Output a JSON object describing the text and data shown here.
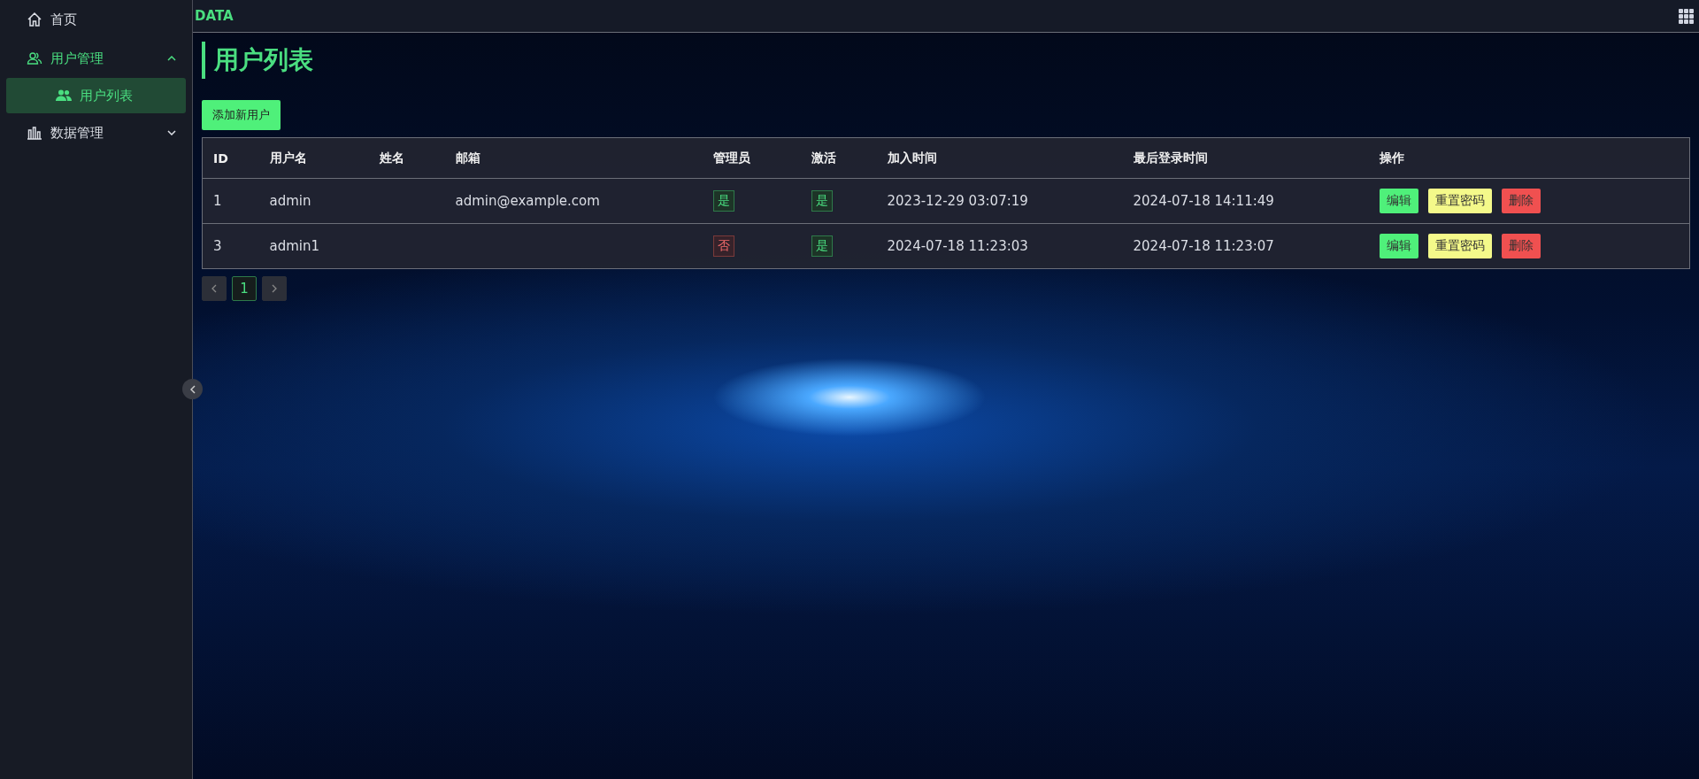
{
  "sidebar": {
    "items": [
      {
        "label": "首页"
      },
      {
        "label": "用户管理",
        "expanded": true,
        "children": [
          {
            "label": "用户列表",
            "selected": true
          }
        ]
      },
      {
        "label": "数据管理",
        "expanded": false
      }
    ]
  },
  "topbar": {
    "brand": "DATA"
  },
  "page": {
    "title": "用户列表",
    "add_button": "添加新用户"
  },
  "table": {
    "columns": [
      "ID",
      "用户名",
      "姓名",
      "邮箱",
      "管理员",
      "激活",
      "加入时间",
      "最后登录时间",
      "操作"
    ],
    "rows": [
      {
        "id": "1",
        "username": "admin",
        "email": "admin@example.com",
        "admin": {
          "label": "是",
          "on": true
        },
        "active": {
          "label": "是",
          "on": true
        },
        "joined": "2023-12-29 03:07:19",
        "last_login": "2024-07-18 14:11:49",
        "actions": [
          {
            "label": "编辑",
            "kind": "edit"
          },
          {
            "label": "重置密码",
            "kind": "reset"
          },
          {
            "label": "删除",
            "kind": "delete"
          }
        ]
      },
      {
        "id": "3",
        "username": "admin1",
        "admin": {
          "label": "否",
          "on": false
        },
        "active": {
          "label": "是",
          "on": true
        },
        "joined": "2024-07-18 11:23:03",
        "last_login": "2024-07-18 11:23:07",
        "actions": [
          {
            "label": "编辑",
            "kind": "edit"
          },
          {
            "label": "重置密码",
            "kind": "reset"
          },
          {
            "label": "删除",
            "kind": "delete"
          }
        ]
      }
    ]
  },
  "pagination": {
    "pages": [
      {
        "label": "1",
        "selected": true
      }
    ]
  }
}
